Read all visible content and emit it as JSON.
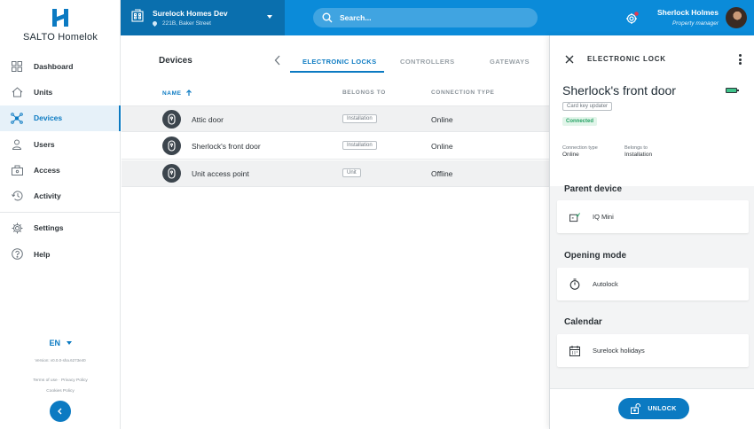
{
  "brand": {
    "name": "SALTO Homelok"
  },
  "sidebar": {
    "items": [
      {
        "label": "Dashboard",
        "icon": "dashboard-icon"
      },
      {
        "label": "Units",
        "icon": "home-icon"
      },
      {
        "label": "Devices",
        "icon": "network-icon",
        "active": true
      },
      {
        "label": "Users",
        "icon": "user-icon"
      },
      {
        "label": "Access",
        "icon": "access-icon"
      },
      {
        "label": "Activity",
        "icon": "history-icon"
      },
      {
        "label": "Settings",
        "icon": "gear-icon"
      },
      {
        "label": "Help",
        "icon": "help-icon"
      }
    ],
    "language": "EN",
    "version": "Version: v0.0.0-sha.6273e40",
    "terms": "Terms of use",
    "privacy": "Privacy Policy",
    "cookies": "Cookies Policy"
  },
  "topbar": {
    "site_name": "Surelock Homes Dev",
    "site_address": "221B, Baker Street",
    "search_placeholder": "Search...",
    "user_name": "Sherlock Holmes",
    "user_role": "Property manager"
  },
  "main": {
    "title": "Devices",
    "tabs": [
      {
        "label": "ELECTRONIC LOCKS",
        "active": true
      },
      {
        "label": "CONTROLLERS"
      },
      {
        "label": "GATEWAYS"
      }
    ],
    "columns": {
      "name": "NAME",
      "belongs_to": "BELONGS TO",
      "connection": "CONNECTION TYPE"
    },
    "rows": [
      {
        "name": "Attic door",
        "belongs_to": "Installation",
        "connection": "Online"
      },
      {
        "name": "Sherlock's front door",
        "belongs_to": "Installation",
        "connection": "Online"
      },
      {
        "name": "Unit access point",
        "belongs_to": "Unit",
        "connection": "Offline"
      }
    ]
  },
  "panel": {
    "header": "ELECTRONIC LOCK",
    "title": "Sherlock's front door",
    "chip": "Card key updater",
    "status": "Connected",
    "connection_type_label": "Connection type",
    "connection_type_value": "Online",
    "belongs_to_label": "Belongs to",
    "belongs_to_value": "Installation",
    "parent_device_title": "Parent device",
    "parent_device": "IQ Mini",
    "opening_mode_title": "Opening mode",
    "opening_mode": "Autolock",
    "calendar_title": "Calendar",
    "calendar": "Surelock holidays",
    "unlock_label": "UNLOCK"
  },
  "colors": {
    "accent": "#0b7ac2",
    "topbar": "#0b8bd9",
    "site_bar": "#0a6fae",
    "connected": "#26a365",
    "battery": "#3fc48a"
  }
}
